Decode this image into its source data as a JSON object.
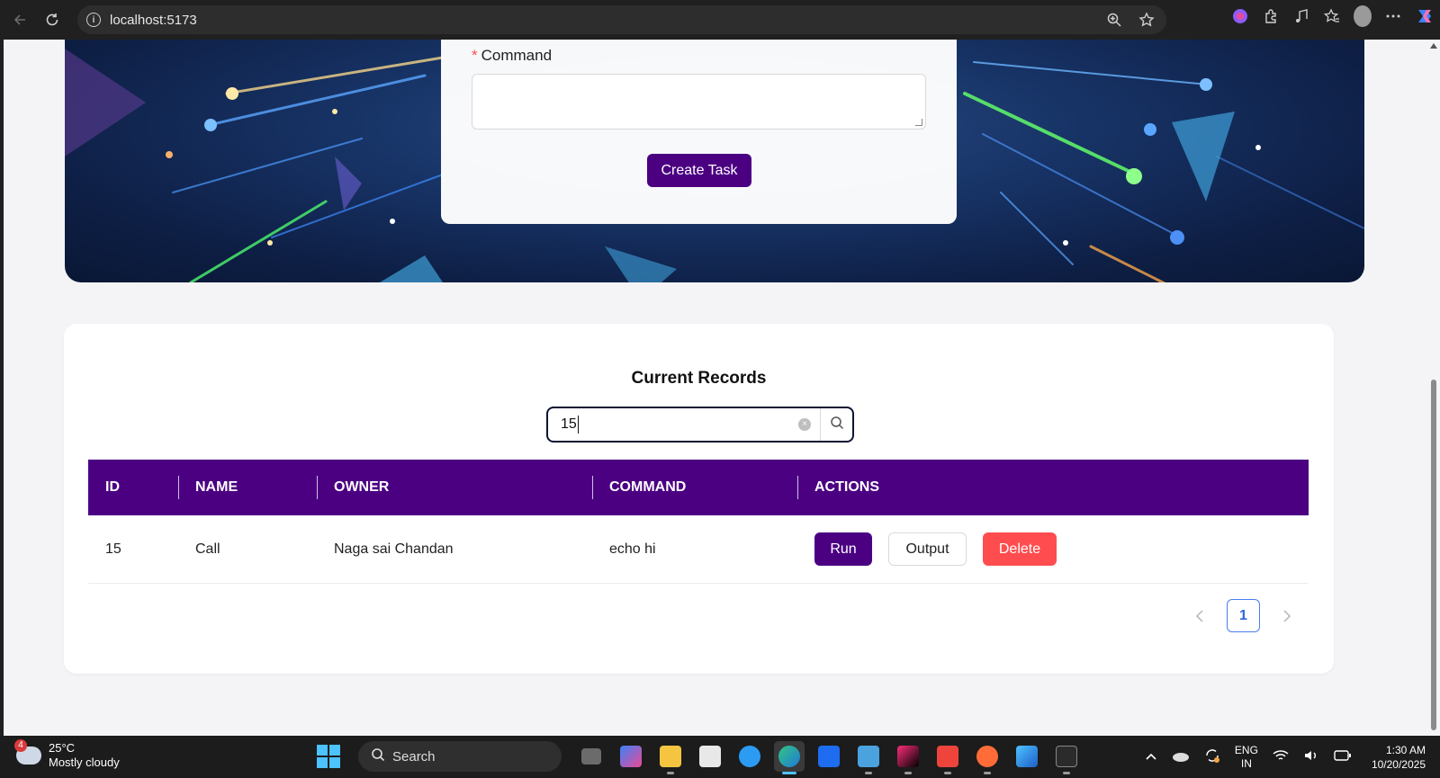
{
  "browser": {
    "url": "localhost:5173",
    "icons": [
      "back-icon",
      "refresh-icon",
      "info-icon",
      "zoom-icon",
      "star-icon",
      "copilot-icon",
      "extensions-icon",
      "media-icon",
      "favorites-icon",
      "profile-icon",
      "more-icon",
      "copilot-sidebar-icon"
    ]
  },
  "form": {
    "command_label": "Command",
    "required_mark": "*",
    "command_value": "",
    "create_button": "Create Task"
  },
  "records": {
    "title": "Current Records",
    "search_value": "15",
    "columns": [
      "ID",
      "NAME",
      "OWNER",
      "COMMAND",
      "ACTIONS"
    ],
    "rows": [
      {
        "id": "15",
        "name": "Call",
        "owner": "Naga sai Chandan",
        "command": "echo hi"
      }
    ],
    "actions": {
      "run": "Run",
      "output": "Output",
      "delete": "Delete"
    },
    "pagination": {
      "current_page": "1"
    }
  },
  "colors": {
    "primary": "#4b0082",
    "danger": "#ff4d4f",
    "page_bg": "#f4f4f6",
    "link": "#2f65e0"
  },
  "taskbar": {
    "weather_temp": "25°C",
    "weather_desc": "Mostly cloudy",
    "weather_badge": "4",
    "search_placeholder": "Search",
    "lang_top": "ENG",
    "lang_bottom": "IN",
    "time": "1:30 AM",
    "date": "10/20/2025"
  }
}
